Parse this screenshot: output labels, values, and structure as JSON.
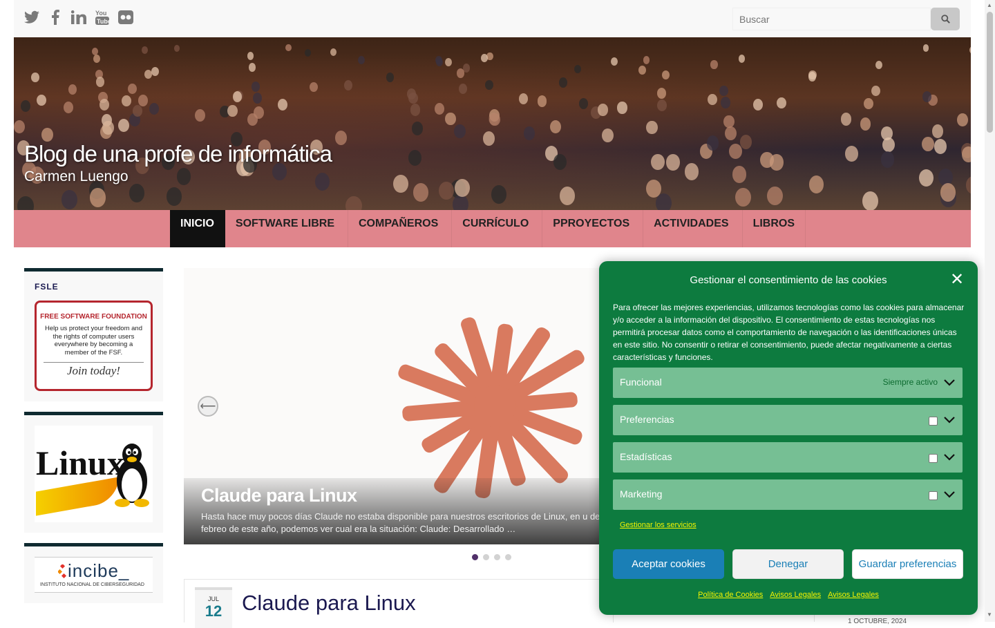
{
  "social": {
    "twitter": "twitter-icon",
    "facebook": "facebook-icon",
    "linkedin": "linkedin-icon",
    "youtube": "youtube-icon",
    "flickr": "flickr-icon"
  },
  "search": {
    "placeholder": "Buscar",
    "icon": "search-icon"
  },
  "header": {
    "title": "Blog de una profe de informática",
    "subtitle": "Carmen Luengo"
  },
  "nav": {
    "items": [
      {
        "label": "Inicio",
        "active": true
      },
      {
        "label": "Software Libre",
        "dropdown": true
      },
      {
        "label": "Compañeros",
        "dropdown": true
      },
      {
        "label": "Currículo",
        "dropdown": true
      },
      {
        "label": "Pproyectos",
        "dropdown": true
      },
      {
        "label": "Actividades",
        "dropdown": true
      },
      {
        "label": "Libros"
      }
    ],
    "caret": ""
  },
  "sidebar": {
    "fsle": {
      "title": "FSLE",
      "banner_org": "FREE SOFTWARE FOUNDATION",
      "banner_text": "Help us protect your freedom and the rights of computer users everywhere by becoming a member of the FSF.",
      "banner_cta": "Join today!"
    },
    "linux": {
      "word": "Linux"
    },
    "incibe": {
      "word": "incibe_",
      "tagline": "INSTITUTO NACIONAL DE CIBERSEGURIDAD"
    }
  },
  "slider": {
    "title": "Claude para Linux",
    "excerpt": "Hasta hace muy pocos días Claude  no estaba disponible para nuestros escritorios de Linux, en u de febreo de este año, podemos ver cual era la situación: Claude: Desarrollado …",
    "dots": 4,
    "active_dot": 1
  },
  "article": {
    "month": "JUL",
    "day": "12",
    "title": "Claude para Linux"
  },
  "rightcol": {
    "partial": "1 OCTUBRE, 2024"
  },
  "cookie": {
    "title": "Gestionar el consentimiento de las cookies",
    "message": "Para ofrecer las mejores experiencias, utilizamos tecnologías como las cookies para almacenar y/o acceder a la información del dispositivo. El consentimiento de estas tecnologías nos permitirá procesar datos como el comportamiento de navegación o las identificaciones únicas en este sitio. No consentir o retirar el consentimiento, puede afectar negativamente a ciertas características y funciones.",
    "categories": [
      {
        "label": "Funcional",
        "always": "Siempre activo"
      },
      {
        "label": "Preferencias"
      },
      {
        "label": "Estadísticas"
      },
      {
        "label": "Marketing"
      }
    ],
    "manage_link": "Gestionar los servicios",
    "buttons": {
      "accept": "Aceptar cookies",
      "deny": "Denegar",
      "save": "Guardar preferencias"
    },
    "links": [
      "Política de Cookies",
      "Avisos Legales",
      "Avisos Legales"
    ],
    "colors": {
      "background": "#0d7b3f",
      "category": "#76bf94",
      "link": "#f5f500",
      "button": "#1a7fb6"
    }
  }
}
